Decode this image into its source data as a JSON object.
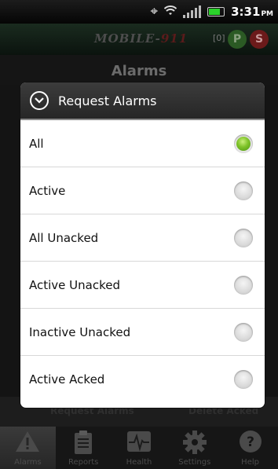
{
  "status_bar": {
    "time": "3:31",
    "ampm": "PM",
    "icons": [
      "gps-icon",
      "wifi-icon",
      "signal-icon",
      "battery-icon"
    ]
  },
  "app_header": {
    "brand_prefix": "MOBILE-",
    "brand_suffix": "911",
    "counter": "[0]",
    "badge_p": "P",
    "badge_s": "S"
  },
  "screen_title": "Alarms",
  "action_bar": {
    "request_label": "Request Alarms",
    "delete_label": "Delete Acked"
  },
  "dialog": {
    "title": "Request Alarms",
    "options": [
      {
        "label": "All",
        "selected": true
      },
      {
        "label": "Active",
        "selected": false
      },
      {
        "label": "All Unacked",
        "selected": false
      },
      {
        "label": "Active Unacked",
        "selected": false
      },
      {
        "label": "Inactive Unacked",
        "selected": false
      },
      {
        "label": "Active Acked",
        "selected": false
      }
    ]
  },
  "tabs": [
    {
      "label": "Alarms",
      "icon": "warning-icon",
      "active": true
    },
    {
      "label": "Reports",
      "icon": "clipboard-icon",
      "active": false
    },
    {
      "label": "Health",
      "icon": "pulse-icon",
      "active": false
    },
    {
      "label": "Settings",
      "icon": "gear-icon",
      "active": false
    },
    {
      "label": "Help",
      "icon": "help-icon",
      "active": false
    }
  ],
  "colors": {
    "radio_selected": "#7fc329",
    "badge_p": "#2b5a24",
    "badge_s": "#6b1a1a",
    "dialog_header": "#2f2f2f"
  }
}
